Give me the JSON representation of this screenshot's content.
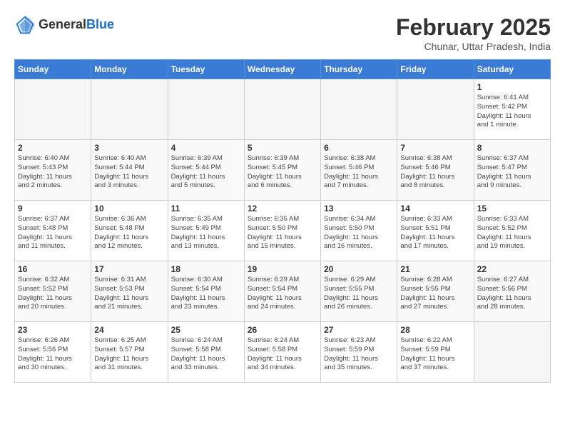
{
  "header": {
    "logo_line1": "General",
    "logo_line2": "Blue",
    "month_title": "February 2025",
    "location": "Chunar, Uttar Pradesh, India"
  },
  "weekdays": [
    "Sunday",
    "Monday",
    "Tuesday",
    "Wednesday",
    "Thursday",
    "Friday",
    "Saturday"
  ],
  "weeks": [
    [
      {
        "day": "",
        "info": ""
      },
      {
        "day": "",
        "info": ""
      },
      {
        "day": "",
        "info": ""
      },
      {
        "day": "",
        "info": ""
      },
      {
        "day": "",
        "info": ""
      },
      {
        "day": "",
        "info": ""
      },
      {
        "day": "1",
        "info": "Sunrise: 6:41 AM\nSunset: 5:42 PM\nDaylight: 11 hours\nand 1 minute."
      }
    ],
    [
      {
        "day": "2",
        "info": "Sunrise: 6:40 AM\nSunset: 5:43 PM\nDaylight: 11 hours\nand 2 minutes."
      },
      {
        "day": "3",
        "info": "Sunrise: 6:40 AM\nSunset: 5:44 PM\nDaylight: 11 hours\nand 3 minutes."
      },
      {
        "day": "4",
        "info": "Sunrise: 6:39 AM\nSunset: 5:44 PM\nDaylight: 11 hours\nand 5 minutes."
      },
      {
        "day": "5",
        "info": "Sunrise: 6:39 AM\nSunset: 5:45 PM\nDaylight: 11 hours\nand 6 minutes."
      },
      {
        "day": "6",
        "info": "Sunrise: 6:38 AM\nSunset: 5:46 PM\nDaylight: 11 hours\nand 7 minutes."
      },
      {
        "day": "7",
        "info": "Sunrise: 6:38 AM\nSunset: 5:46 PM\nDaylight: 11 hours\nand 8 minutes."
      },
      {
        "day": "8",
        "info": "Sunrise: 6:37 AM\nSunset: 5:47 PM\nDaylight: 11 hours\nand 9 minutes."
      }
    ],
    [
      {
        "day": "9",
        "info": "Sunrise: 6:37 AM\nSunset: 5:48 PM\nDaylight: 11 hours\nand 11 minutes."
      },
      {
        "day": "10",
        "info": "Sunrise: 6:36 AM\nSunset: 5:48 PM\nDaylight: 11 hours\nand 12 minutes."
      },
      {
        "day": "11",
        "info": "Sunrise: 6:35 AM\nSunset: 5:49 PM\nDaylight: 11 hours\nand 13 minutes."
      },
      {
        "day": "12",
        "info": "Sunrise: 6:35 AM\nSunset: 5:50 PM\nDaylight: 11 hours\nand 15 minutes."
      },
      {
        "day": "13",
        "info": "Sunrise: 6:34 AM\nSunset: 5:50 PM\nDaylight: 11 hours\nand 16 minutes."
      },
      {
        "day": "14",
        "info": "Sunrise: 6:33 AM\nSunset: 5:51 PM\nDaylight: 11 hours\nand 17 minutes."
      },
      {
        "day": "15",
        "info": "Sunrise: 6:33 AM\nSunset: 5:52 PM\nDaylight: 11 hours\nand 19 minutes."
      }
    ],
    [
      {
        "day": "16",
        "info": "Sunrise: 6:32 AM\nSunset: 5:52 PM\nDaylight: 11 hours\nand 20 minutes."
      },
      {
        "day": "17",
        "info": "Sunrise: 6:31 AM\nSunset: 5:53 PM\nDaylight: 11 hours\nand 21 minutes."
      },
      {
        "day": "18",
        "info": "Sunrise: 6:30 AM\nSunset: 5:54 PM\nDaylight: 11 hours\nand 23 minutes."
      },
      {
        "day": "19",
        "info": "Sunrise: 6:29 AM\nSunset: 5:54 PM\nDaylight: 11 hours\nand 24 minutes."
      },
      {
        "day": "20",
        "info": "Sunrise: 6:29 AM\nSunset: 5:55 PM\nDaylight: 11 hours\nand 26 minutes."
      },
      {
        "day": "21",
        "info": "Sunrise: 6:28 AM\nSunset: 5:55 PM\nDaylight: 11 hours\nand 27 minutes."
      },
      {
        "day": "22",
        "info": "Sunrise: 6:27 AM\nSunset: 5:56 PM\nDaylight: 11 hours\nand 28 minutes."
      }
    ],
    [
      {
        "day": "23",
        "info": "Sunrise: 6:26 AM\nSunset: 5:56 PM\nDaylight: 11 hours\nand 30 minutes."
      },
      {
        "day": "24",
        "info": "Sunrise: 6:25 AM\nSunset: 5:57 PM\nDaylight: 11 hours\nand 31 minutes."
      },
      {
        "day": "25",
        "info": "Sunrise: 6:24 AM\nSunset: 5:58 PM\nDaylight: 11 hours\nand 33 minutes."
      },
      {
        "day": "26",
        "info": "Sunrise: 6:24 AM\nSunset: 5:58 PM\nDaylight: 11 hours\nand 34 minutes."
      },
      {
        "day": "27",
        "info": "Sunrise: 6:23 AM\nSunset: 5:59 PM\nDaylight: 11 hours\nand 35 minutes."
      },
      {
        "day": "28",
        "info": "Sunrise: 6:22 AM\nSunset: 5:59 PM\nDaylight: 11 hours\nand 37 minutes."
      },
      {
        "day": "",
        "info": ""
      }
    ]
  ]
}
